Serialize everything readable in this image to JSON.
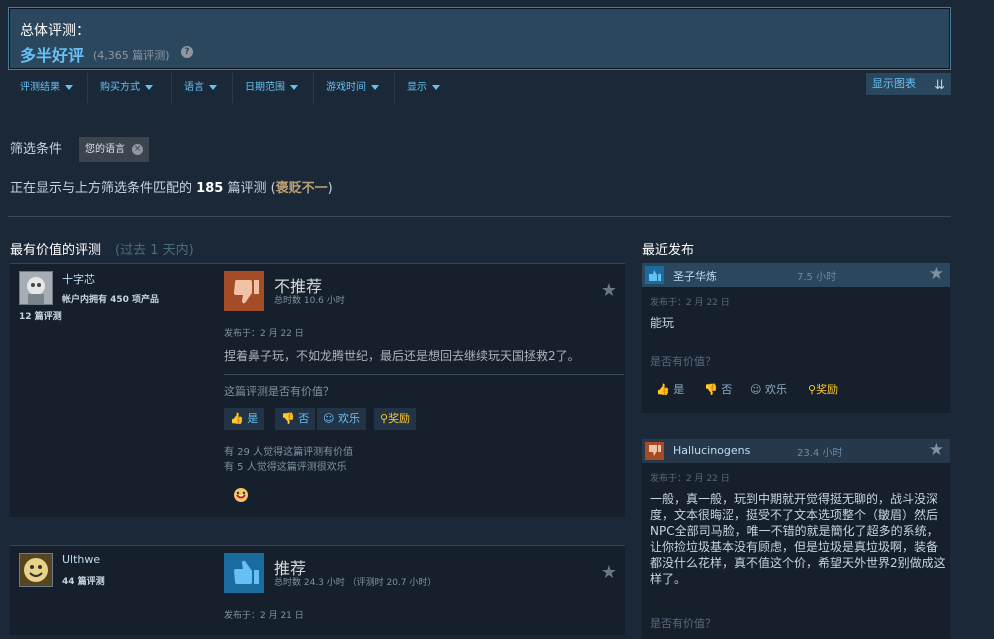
{
  "summary": {
    "title": "总体评测：",
    "rating": "多半好评",
    "count": "(4,365 篇评测)",
    "help_glyph": "?"
  },
  "filters": {
    "items": [
      "评测结果",
      "购买方式",
      "语言",
      "日期范围",
      "游戏时间",
      "显示"
    ],
    "show_graph": "显示图表"
  },
  "active_filters": {
    "label": "筛选条件",
    "chip": "您的语言"
  },
  "showing": {
    "prefix": "正在显示与上方筛选条件匹配的",
    "count": "185",
    "suffix": "篇评测 (",
    "rating": "褒贬不一",
    "close": ")"
  },
  "sections": {
    "most_helpful": "最有价值的评测",
    "most_helpful_period": "(过去 1 天内)",
    "recent": "最近发布"
  },
  "reviews": [
    {
      "user": "十字芯",
      "products": "帐户内拥有 450 项产品",
      "review_count": "12 篇评测",
      "verdict": "不推荐",
      "hours": "总时数 10.6 小时",
      "posted": "发布于：2 月 22 日",
      "body": "捏着鼻子玩，不如龙腾世纪，最后还是想回去继续玩天国拯救2了。",
      "helpful_q": "这篇评测是否有价值？",
      "buttons": {
        "yes": "是",
        "no": "否",
        "funny": "欢乐",
        "award": "奖励"
      },
      "stat1": "有 29 人觉得这篇评测有价值",
      "stat2": "有 5 人觉得这篇评测很欢乐"
    },
    {
      "user": "Ulthwe",
      "review_count": "44 篇评测",
      "verdict": "推荐",
      "hours": "总时数 24.3 小时 （评测时 20.7 小时）",
      "posted": "发布于：2 月 21 日"
    }
  ],
  "recent": [
    {
      "user": "圣子华炼",
      "hours": "7.5 小时",
      "posted": "发布于：2 月 22 日",
      "body": "能玩",
      "helpful_q": "是否有价值？",
      "buttons": {
        "yes": "是",
        "no": "否",
        "funny": "欢乐",
        "award": "奖励"
      }
    },
    {
      "user": "Hallucinogens",
      "hours": "23.4 小时",
      "posted": "发布于：2 月 22 日",
      "body": "一般，真一般，玩到中期就开觉得挺无聊的，战斗没深度，文本很晦涩，挺受不了文本选项整个（皺眉）然后NPC全部司马脸，唯一不错的就是簡化了超多的系统，让你捡垃圾基本没有顾虑，但是垃圾是真垃圾啊，装备都没什么花样，真不值这个价，希望天外世界2别做成这样了。",
      "helpful_q": "是否有价值？"
    }
  ],
  "colors": {
    "positive": "#66c0f4",
    "mixed": "#b9a074",
    "thumb_down_bg": "#a34c25",
    "thumb_up_bg": "#1a9fff"
  }
}
